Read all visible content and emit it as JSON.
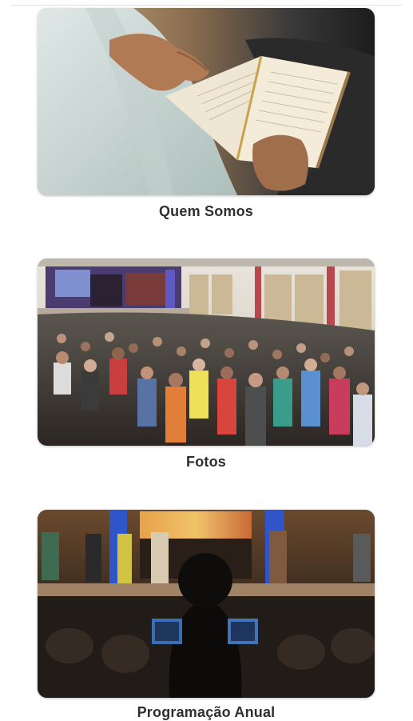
{
  "cards": [
    {
      "label": "Quem Somos",
      "image": "bible-reading-photo"
    },
    {
      "label": "Fotos",
      "image": "church-congregation-photo"
    },
    {
      "label": "Programação Anual",
      "image": "worship-stage-photo"
    }
  ]
}
